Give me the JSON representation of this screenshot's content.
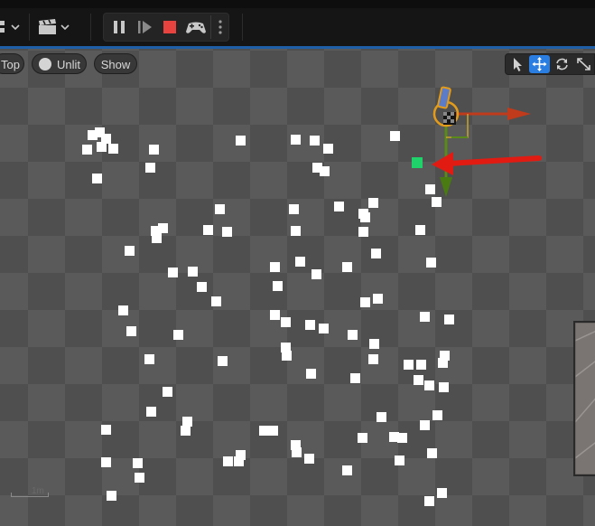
{
  "viewport_toolbar": {
    "view_mode": "Top",
    "lighting_mode": "Unlit",
    "show_label": "Show"
  },
  "scale_bar": {
    "label": "1m"
  },
  "transform_tools": {
    "active": "translate",
    "items": [
      "select-icon",
      "translate-icon",
      "rotate-icon",
      "scale-icon"
    ]
  },
  "play_controls": [
    "pause-icon",
    "step-frame-icon",
    "stop-icon",
    "gamepad-icon",
    "more-options-icon"
  ],
  "colors": {
    "stop_button": "#e8433e",
    "gizmo_x": "#c03a1c",
    "gizmo_y": "#5a8a1a",
    "selected_actor": "#1fd36a",
    "annotation_arrow": "#e21b12",
    "active_tool": "#2a7de1"
  },
  "scene": {
    "actor_count": 117,
    "selected_actor_marker": "green-square"
  }
}
